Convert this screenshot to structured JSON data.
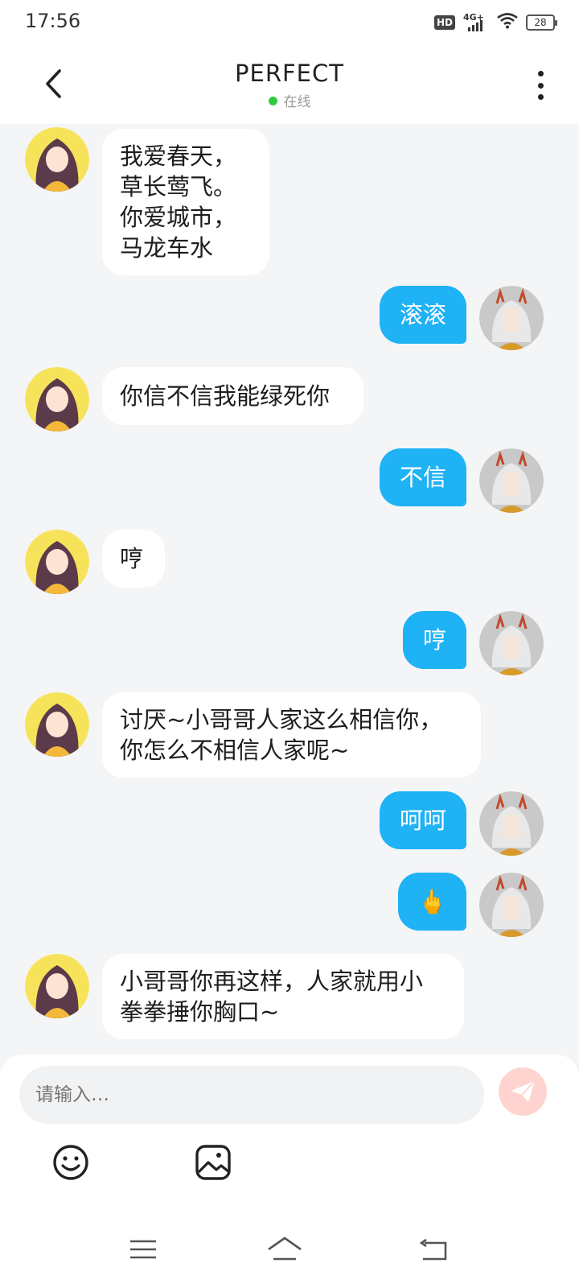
{
  "status_bar": {
    "time": "17:56",
    "hd_badge": "HD",
    "network": "4G+",
    "battery": "28"
  },
  "header": {
    "title": "PERFECT",
    "status": "在线",
    "status_color": "#2ecc40"
  },
  "messages": [
    {
      "side": "left",
      "text": "我爱春天，\n草长莺飞。\n你爱城市，\n马龙车水"
    },
    {
      "side": "right",
      "text": "滚滚"
    },
    {
      "side": "left",
      "text": "你信不信我能绿死你"
    },
    {
      "side": "right",
      "text": "不信"
    },
    {
      "side": "left",
      "text": "哼"
    },
    {
      "side": "right",
      "text": "哼"
    },
    {
      "side": "left",
      "text": "讨厌~小哥哥人家这么相信你，\n你怎么不相信人家呢~"
    },
    {
      "side": "right",
      "text": "呵呵"
    },
    {
      "side": "right",
      "text": "🖕"
    },
    {
      "side": "left",
      "text": "小哥哥你再这样，人家就用小\n拳拳捶你胸口~"
    }
  ],
  "composer": {
    "placeholder": "请输入…",
    "send_icon": "send-icon",
    "tools": [
      "emoji-icon",
      "image-icon"
    ]
  },
  "navigation": [
    "menu-icon",
    "home-icon",
    "back-icon"
  ],
  "colors": {
    "accent": "#1fb2f5",
    "left_bubble": "#ffffff",
    "background": "#f4f5f7",
    "send_button": "#ffd4d0"
  }
}
